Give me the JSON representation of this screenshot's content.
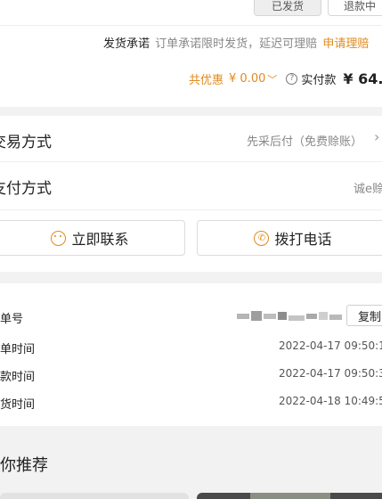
{
  "top_buttons": {
    "shipped_label": "已发货",
    "refund_label": "退款中"
  },
  "shipping_promise": {
    "label": "发货承诺",
    "text": "订单承诺限时发货，延迟可理赔",
    "link": "申请理赔"
  },
  "price_summary": {
    "discount_label": "共优惠",
    "discount_value": "¥ 0.00",
    "paid_label": "实付款",
    "paid_value": "¥ 64."
  },
  "transaction": {
    "label": "交易方式",
    "value": "先采后付（免费赊账）"
  },
  "payment": {
    "label": "支付方式",
    "value": "诚e赊"
  },
  "contact": {
    "chat_label": "立即联系",
    "call_label": "拨打电话"
  },
  "order_info": {
    "order_no_label": "单号",
    "copy_label": "复制",
    "rows": [
      {
        "label": "单时间",
        "value": "2022-04-17 09:50:1"
      },
      {
        "label": "款时间",
        "value": "2022-04-17 09:50:3"
      },
      {
        "label": "货时间",
        "value": "2022-04-18 10:49:5"
      }
    ]
  },
  "recommend": {
    "title": "为你推荐"
  },
  "colors": {
    "accent": "#e08a1f",
    "background": "#f2f2f2"
  }
}
